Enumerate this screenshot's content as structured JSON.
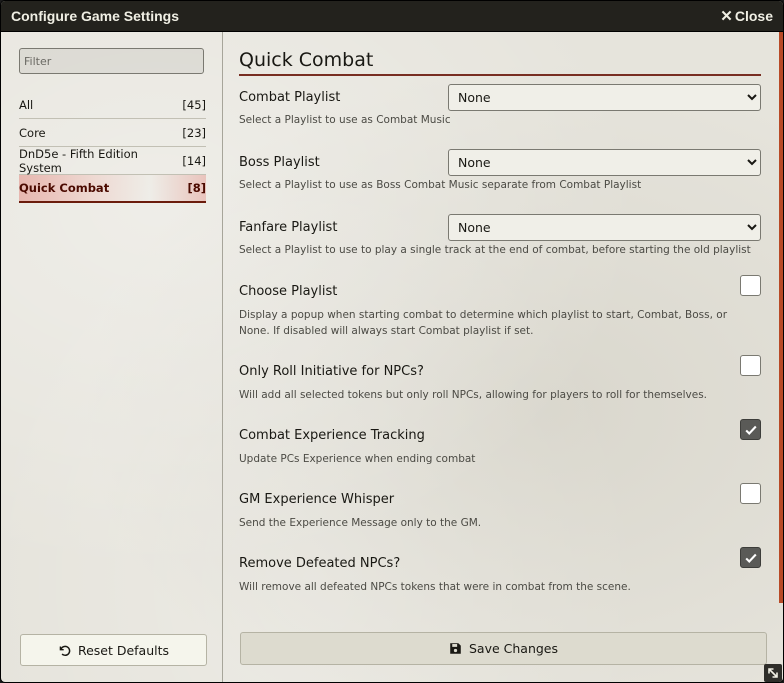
{
  "window": {
    "title": "Configure Game Settings",
    "close_label": "Close"
  },
  "sidebar": {
    "filter_placeholder": "Filter",
    "categories": [
      {
        "label": "All",
        "count": "[45]"
      },
      {
        "label": "Core",
        "count": "[23]"
      },
      {
        "label": "DnD5e - Fifth Edition System",
        "count": "[14]"
      },
      {
        "label": "Quick Combat",
        "count": "[8]",
        "active": true
      }
    ],
    "reset_label": "Reset Defaults"
  },
  "main": {
    "section_title": "Quick Combat",
    "settings": [
      {
        "label": "Combat Playlist",
        "type": "select",
        "value": "None",
        "hint": "Select a Playlist to use as Combat Music"
      },
      {
        "label": "Boss Playlist",
        "type": "select",
        "value": "None",
        "hint": "Select a Playlist to use as Boss Combat Music separate from Combat Playlist"
      },
      {
        "label": "Fanfare Playlist",
        "type": "select",
        "value": "None",
        "hint": "Select a Playlist to use to play a single track at the end of combat, before starting the old playlist"
      },
      {
        "label": "Choose Playlist",
        "type": "checkbox",
        "checked": false,
        "hint": "Display a popup when starting combat to determine which playlist to start, Combat, Boss, or None. If disabled will always start Combat playlist if set."
      },
      {
        "label": "Only Roll Initiative for NPCs?",
        "type": "checkbox",
        "checked": false,
        "hint": "Will add all selected tokens but only roll NPCs, allowing for players to roll for themselves."
      },
      {
        "label": "Combat Experience Tracking",
        "type": "checkbox",
        "checked": true,
        "hint": "Update PCs Experience when ending combat"
      },
      {
        "label": "GM Experience Whisper",
        "type": "checkbox",
        "checked": false,
        "hint": "Send the Experience Message only to the GM."
      },
      {
        "label": "Remove Defeated NPCs?",
        "type": "checkbox",
        "checked": true,
        "hint": "Will remove all defeated NPCs tokens that were in combat from the scene."
      }
    ],
    "save_label": "Save Changes"
  },
  "icons": {
    "close": "close-icon",
    "reset": "undo-icon",
    "save": "save-icon",
    "check": "check-icon",
    "resize": "resize-icon"
  },
  "colors": {
    "titlebar": "#23221d",
    "accent": "#782e22",
    "scrollbar": "#b84a26",
    "active_category": "#4b0a00"
  }
}
